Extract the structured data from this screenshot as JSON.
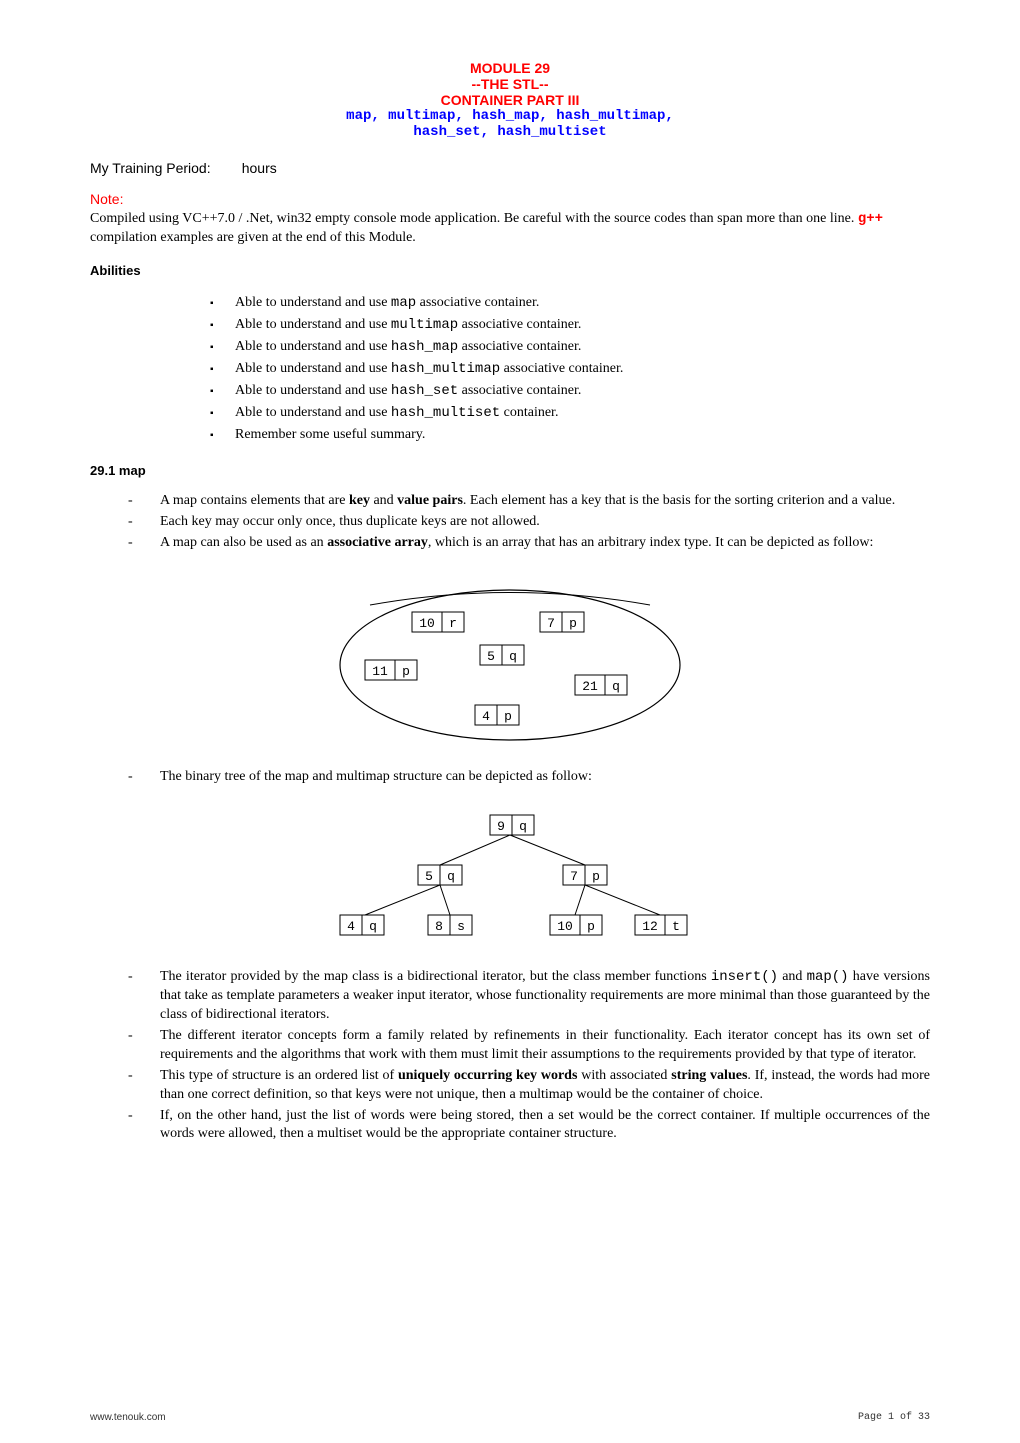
{
  "header": {
    "module": "MODULE 29",
    "stl": "--THE STL--",
    "container": "CONTAINER PART III",
    "line1": "map, multimap, hash_map, hash_multimap,",
    "line2": "hash_set, hash_multiset"
  },
  "training": {
    "label": "My Training Period:",
    "unit": "hours"
  },
  "note": {
    "heading": "Note:",
    "body_a": "Compiled using VC++7.0 / .Net, win32 empty console mode application.  Be careful with the source codes than span more than one line.  ",
    "gpp": "g++",
    "body_b": " compilation examples are given at the end of this Module."
  },
  "abilities": {
    "heading": "Abilities",
    "items": [
      {
        "pre": "Able to understand and use ",
        "code": "map",
        "post": " associative container."
      },
      {
        "pre": "Able to understand and use ",
        "code": "multimap",
        "post": " associative container."
      },
      {
        "pre": "Able to understand and use ",
        "code": "hash_map",
        "post": " associative container."
      },
      {
        "pre": "Able to understand and use ",
        "code": "hash_multimap",
        "post": " associative container."
      },
      {
        "pre": "Able to understand and use ",
        "code": "hash_set",
        "post": " associative container."
      },
      {
        "pre": "Able to understand and use ",
        "code": "hash_multiset",
        "post": " container."
      },
      {
        "pre": "Remember some useful summary.",
        "code": "",
        "post": ""
      }
    ]
  },
  "section": {
    "heading": "29.1  map"
  },
  "list1": {
    "items": [
      "A map contains elements that are <b>key</b> and <b>value pairs</b>. Each element has a key that is the basis for the sorting criterion and a value.",
      "Each key may occur only once, thus duplicate keys are not allowed.",
      "A map can also be used as an <b>associative array</b><i>,</i> which is an array that has an arbitrary index type.  It can be depicted as follow:"
    ]
  },
  "mid": {
    "text": "The binary tree of the map and multimap structure can be depicted as follow:"
  },
  "chart_data": [
    {
      "type": "diagram",
      "kind": "set-ellipse",
      "nodes": [
        {
          "key": "10",
          "val": "r"
        },
        {
          "key": "7",
          "val": "p"
        },
        {
          "key": "5",
          "val": "q"
        },
        {
          "key": "11",
          "val": "p"
        },
        {
          "key": "21",
          "val": "q"
        },
        {
          "key": "4",
          "val": "p"
        }
      ]
    },
    {
      "type": "diagram",
      "kind": "binary-tree",
      "root": {
        "key": "9",
        "val": "q"
      },
      "level1": [
        {
          "key": "5",
          "val": "q"
        },
        {
          "key": "7",
          "val": "p"
        }
      ],
      "level2": [
        {
          "key": "4",
          "val": "q"
        },
        {
          "key": "8",
          "val": "s"
        },
        {
          "key": "10",
          "val": "p"
        },
        {
          "key": "12",
          "val": "t"
        }
      ]
    }
  ],
  "list2": {
    "items": [
      "The iterator provided by the map class is a bidirectional iterator, but the class member functions <span class=\"mono\">insert()</span> and <span class=\"mono\">map()</span> have versions that take as template parameters a weaker input iterator, whose functionality requirements are more minimal than those guaranteed by the class of bidirectional iterators.",
      "The different iterator concepts form a family related by refinements in their functionality.  Each iterator concept has its own set of requirements and the algorithms that work with them must limit their assumptions to the requirements provided by that type of iterator.",
      "This type of structure is an ordered list of <b>uniquely occurring key words</b> with associated <b>string values</b>. If, instead, the words had more than one correct definition, so that keys were not unique, then a multimap would be the container of choice.",
      "If, on the other hand, just the list of words were being stored, then a set would be the correct container.  If multiple occurrences of the words were allowed, then a multiset would be the appropriate container structure."
    ]
  },
  "footer": {
    "site": "www.tenouk.com",
    "page": "Page 1 of 33"
  }
}
